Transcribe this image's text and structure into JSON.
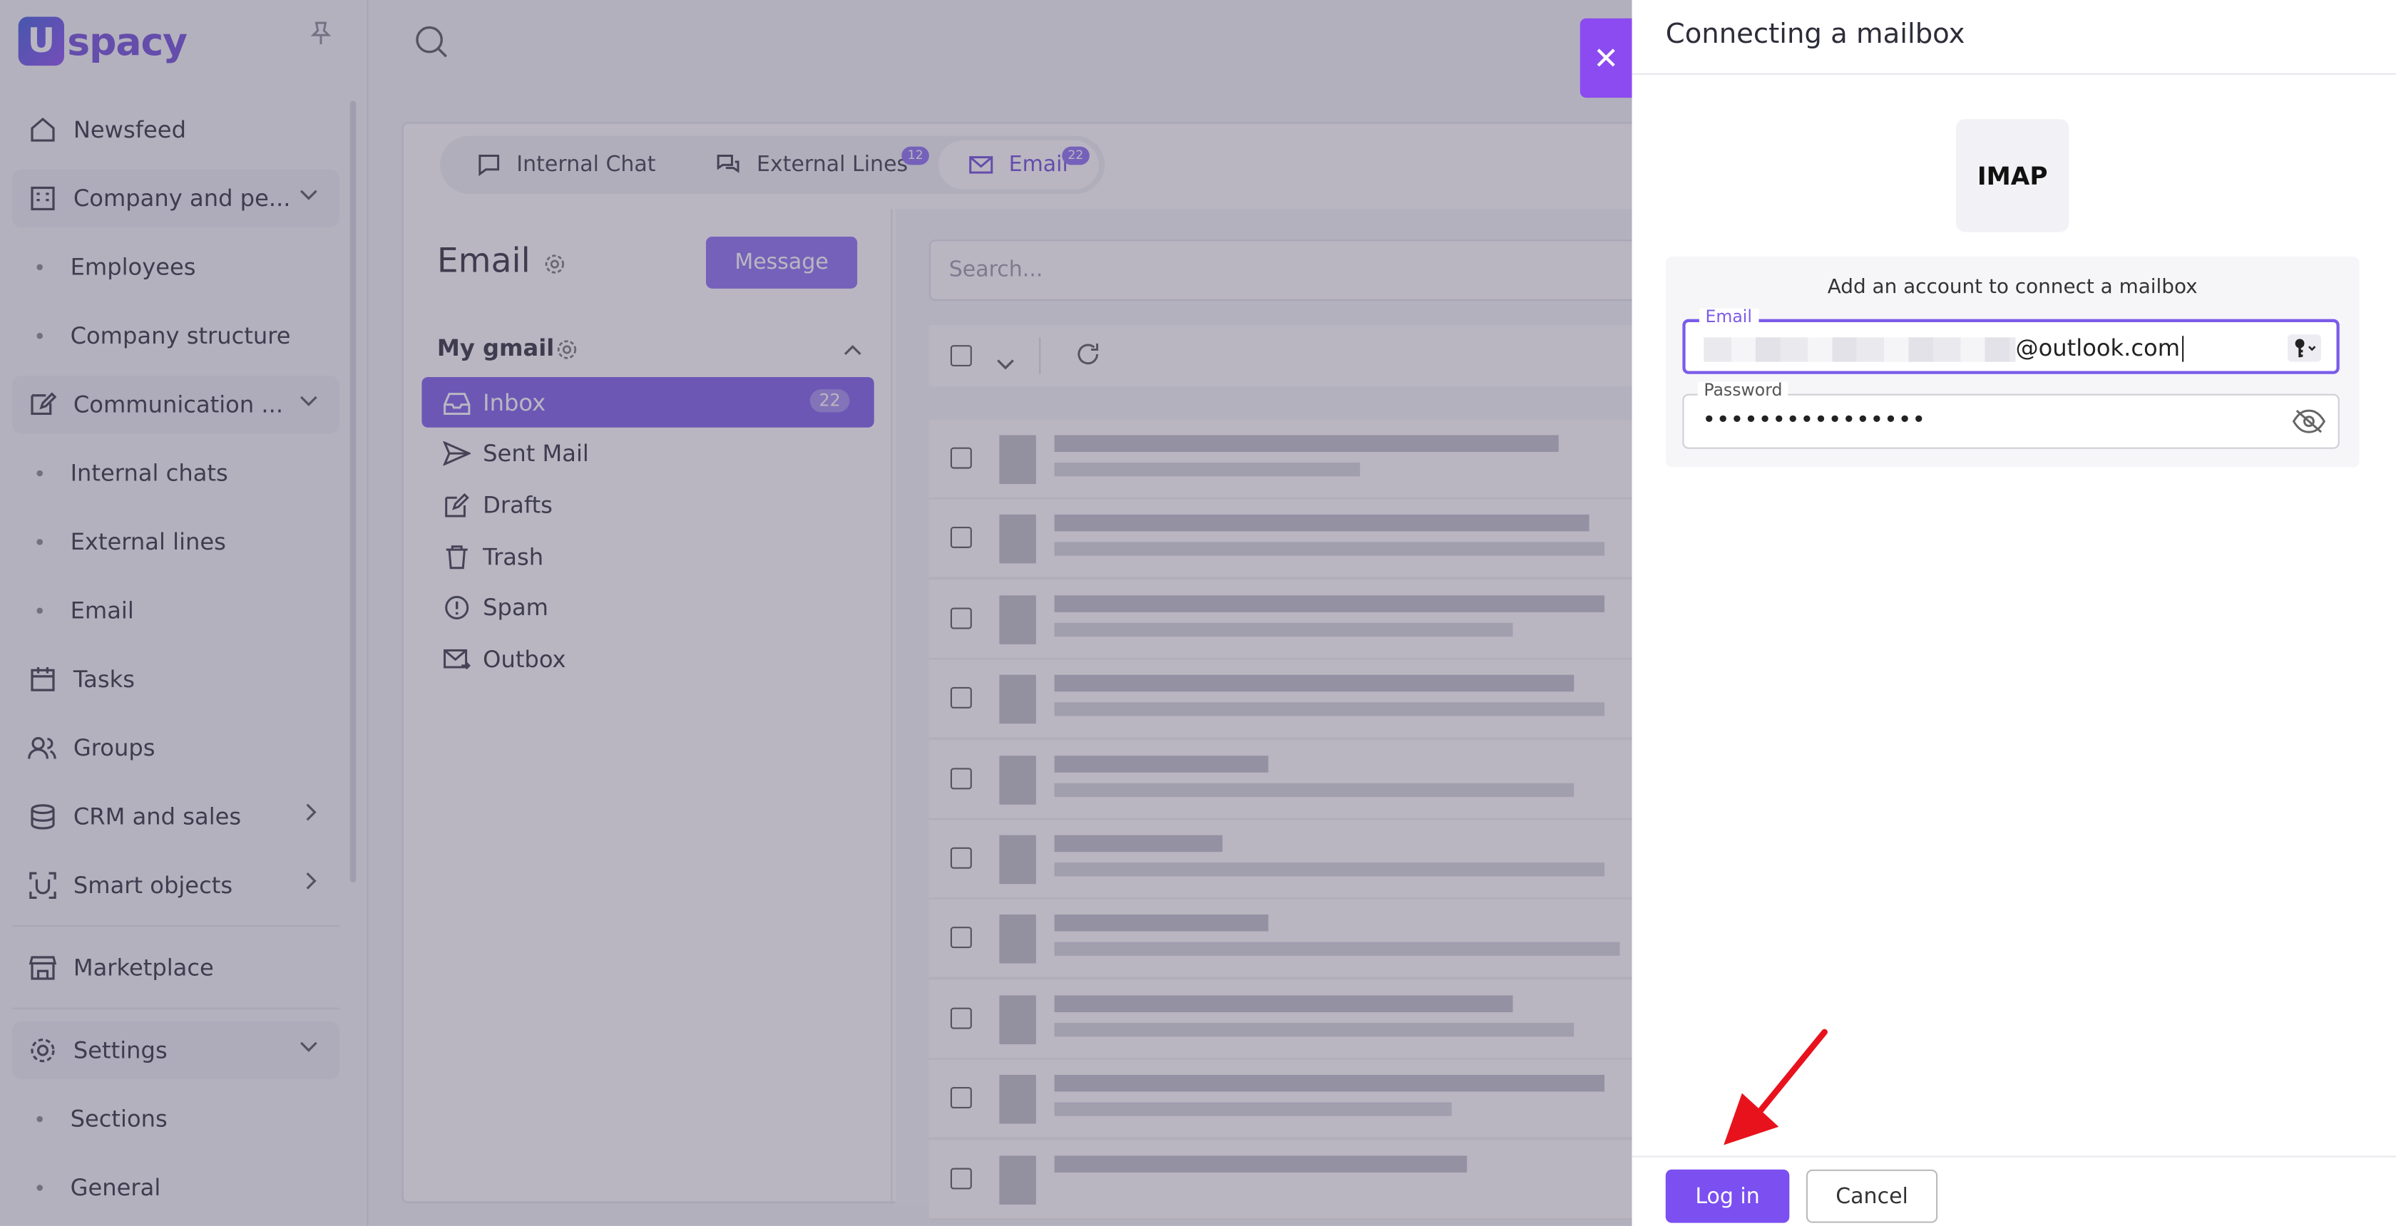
{
  "sidebar": {
    "logo_text": "spacy",
    "logo_letter": "U",
    "items": [
      {
        "label": "Newsfeed"
      },
      {
        "label": "Company and pe..."
      },
      {
        "label": "Employees"
      },
      {
        "label": "Company structure"
      },
      {
        "label": "Communication ..."
      },
      {
        "label": "Internal chats"
      },
      {
        "label": "External lines"
      },
      {
        "label": "Email"
      },
      {
        "label": "Tasks"
      },
      {
        "label": "Groups"
      },
      {
        "label": "CRM and sales"
      },
      {
        "label": "Smart objects"
      },
      {
        "label": "Marketplace"
      },
      {
        "label": "Settings"
      },
      {
        "label": "Sections"
      },
      {
        "label": "General"
      }
    ]
  },
  "tabs": [
    {
      "label": "Internal Chat"
    },
    {
      "label": "External Lines",
      "badge": "12"
    },
    {
      "label": "Email",
      "badge": "22"
    }
  ],
  "email_panel": {
    "title": "Email",
    "message_button": "Message",
    "account": "My gmail",
    "folders": [
      {
        "label": "Inbox",
        "count": "22"
      },
      {
        "label": "Sent Mail"
      },
      {
        "label": "Drafts"
      },
      {
        "label": "Trash"
      },
      {
        "label": "Spam"
      },
      {
        "label": "Outbox"
      }
    ],
    "search_placeholder": "Search..."
  },
  "drawer": {
    "title": "Connecting a mailbox",
    "provider": "IMAP",
    "instruction": "Add an account to connect a mailbox",
    "email_label": "Email",
    "email_value_suffix": "@outlook.com",
    "password_label": "Password",
    "password_mask": "••••••••••••••••",
    "login_button": "Log in",
    "cancel_button": "Cancel",
    "close_symbol": "✕"
  },
  "colors": {
    "accent": "#7b5ce8",
    "brand": "#8b4bf0",
    "arrow": "#e8121c"
  }
}
